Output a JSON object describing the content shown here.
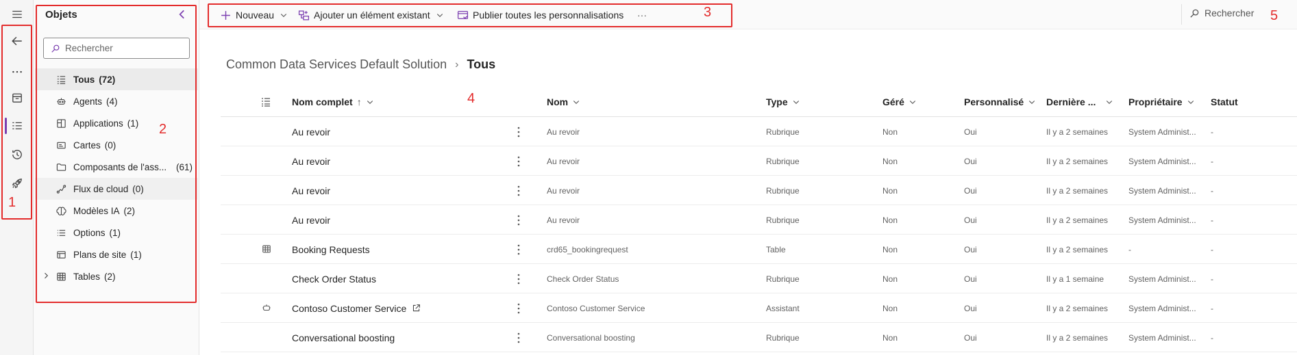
{
  "sidebar": {
    "title": "Objets",
    "search_placeholder": "Rechercher",
    "items": [
      {
        "label": "Tous",
        "count": "(72)"
      },
      {
        "label": "Agents",
        "count": "(4)"
      },
      {
        "label": "Applications",
        "count": "(1)"
      },
      {
        "label": "Cartes",
        "count": "(0)"
      },
      {
        "label": "Composants de l'ass...",
        "count": "(61)"
      },
      {
        "label": "Flux de cloud",
        "count": "(0)"
      },
      {
        "label": "Modèles IA",
        "count": "(2)"
      },
      {
        "label": "Options",
        "count": "(1)"
      },
      {
        "label": "Plans de site",
        "count": "(1)"
      },
      {
        "label": "Tables",
        "count": "(2)"
      }
    ]
  },
  "commandbar": {
    "new_label": "Nouveau",
    "add_existing_label": "Ajouter un élément existant",
    "publish_label": "Publier toutes les personnalisations",
    "more_label": "···",
    "search_label": "Rechercher"
  },
  "breadcrumb": {
    "parent": "Common Data Services Default Solution",
    "current": "Tous"
  },
  "table": {
    "columns": {
      "full_name": "Nom complet",
      "sort_indicator": "↑",
      "name": "Nom",
      "type": "Type",
      "managed": "Géré",
      "customized": "Personnalisé",
      "modified": "Dernière ...",
      "owner": "Propriétaire",
      "status": "Statut"
    },
    "rows": [
      {
        "full_name": "Au revoir",
        "name": "Au revoir",
        "type": "Rubrique",
        "managed": "Non",
        "customized": "Oui",
        "modified": "Il y a 2 semaines",
        "owner": "System Administ...",
        "status": "-"
      },
      {
        "full_name": "Au revoir",
        "name": "Au revoir",
        "type": "Rubrique",
        "managed": "Non",
        "customized": "Oui",
        "modified": "Il y a 2 semaines",
        "owner": "System Administ...",
        "status": "-"
      },
      {
        "full_name": "Au revoir",
        "name": "Au revoir",
        "type": "Rubrique",
        "managed": "Non",
        "customized": "Oui",
        "modified": "Il y a 2 semaines",
        "owner": "System Administ...",
        "status": "-"
      },
      {
        "full_name": "Au revoir",
        "name": "Au revoir",
        "type": "Rubrique",
        "managed": "Non",
        "customized": "Oui",
        "modified": "Il y a 2 semaines",
        "owner": "System Administ...",
        "status": "-"
      },
      {
        "full_name": "Booking Requests",
        "name": "crd65_bookingrequest",
        "type": "Table",
        "managed": "Non",
        "customized": "Oui",
        "modified": "Il y a 2 semaines",
        "owner": "-",
        "status": "-"
      },
      {
        "full_name": "Check Order Status",
        "name": "Check Order Status",
        "type": "Rubrique",
        "managed": "Non",
        "customized": "Oui",
        "modified": "Il y a 1 semaine",
        "owner": "System Administ...",
        "status": "-"
      },
      {
        "full_name": "Contoso Customer Service",
        "name": "Contoso Customer Service",
        "type": "Assistant",
        "managed": "Non",
        "customized": "Oui",
        "modified": "Il y a 2 semaines",
        "owner": "System Administ...",
        "status": "-"
      },
      {
        "full_name": "Conversational boosting",
        "name": "Conversational boosting",
        "type": "Rubrique",
        "managed": "Non",
        "customized": "Oui",
        "modified": "Il y a 2 semaines",
        "owner": "System Administ...",
        "status": "-"
      }
    ]
  },
  "annotations": [
    "1",
    "2",
    "3",
    "4",
    "5"
  ],
  "colors": {
    "accent": "#7b3fb0",
    "annotation": "#e32b2b"
  }
}
